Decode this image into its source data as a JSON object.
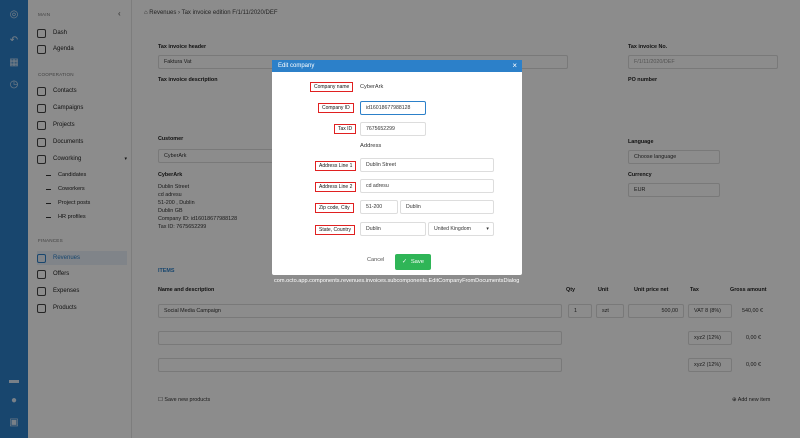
{
  "rail": {
    "icons": [
      "logo-icon",
      "back-icon",
      "grid-icon",
      "history-icon",
      "flag-icon",
      "user-icon",
      "lock-icon"
    ]
  },
  "sidebar": {
    "collapse": "‹",
    "main_heading": "MAIN",
    "main_items": [
      {
        "label": "Dash",
        "icon": "dashboard-icon"
      },
      {
        "label": "Agenda",
        "icon": "calendar-icon"
      }
    ],
    "coop_heading": "COOPERATION",
    "coop_items": [
      {
        "label": "Contacts",
        "icon": "contacts-icon"
      },
      {
        "label": "Campaigns",
        "icon": "campaigns-icon"
      },
      {
        "label": "Projects",
        "icon": "projects-icon"
      },
      {
        "label": "Documents",
        "icon": "documents-icon"
      },
      {
        "label": "Coworking",
        "icon": "coworking-icon"
      }
    ],
    "coworking_sub": [
      "Candidates",
      "Coworkers",
      "Project posts",
      "HR profiles"
    ],
    "finances_heading": "FINANCES",
    "finances_items": [
      {
        "label": "Revenues",
        "icon": "revenues-icon",
        "active": true
      },
      {
        "label": "Offers",
        "icon": "offers-icon"
      },
      {
        "label": "Expenses",
        "icon": "expenses-icon"
      },
      {
        "label": "Products",
        "icon": "products-icon"
      }
    ]
  },
  "breadcrumb": {
    "root": "Revenues",
    "separator": "›",
    "current": "Tax invoice edition F/1/11/2020/DEF"
  },
  "form": {
    "header_label": "Tax invoice header",
    "header_value": "Faktura Vat",
    "description_label": "Tax invoice description",
    "number_label": "Tax invoice No.",
    "number_value": "F/1/11/2020/DEF",
    "po_label": "PO number",
    "customer_label": "Customer",
    "customer_value": "CyberArk",
    "customer_name": "CyberArk",
    "customer_address": [
      "Dublin Street",
      "cd adresu",
      "51-200 , Dublin",
      "Dublin GB",
      "Company ID: id16018677988128",
      "Tax ID: 7675652299"
    ],
    "language_label": "Language",
    "language_value": "Choose language",
    "currency_label": "Currency",
    "currency_value": "EUR"
  },
  "items": {
    "title": "ITEMS",
    "columns": [
      "Name and description",
      "Qty",
      "Unit",
      "Unit price net",
      "Tax",
      "Gross amount"
    ],
    "rows": [
      {
        "name": "Social Media Campaign",
        "qty": "1",
        "unit": "szt",
        "price": "500,00",
        "tax": "VAT 8 (8%)",
        "gross": "540,00 €"
      },
      {
        "name": "",
        "qty": "",
        "unit": "",
        "price": "",
        "tax": "xyz2 (12%)",
        "gross": "0,00 €"
      },
      {
        "name": "",
        "qty": "",
        "unit": "",
        "price": "",
        "tax": "xyz2 (12%)",
        "gross": "0,00 €"
      }
    ],
    "save_new": "Save new products",
    "add_new": "Add new item"
  },
  "modal": {
    "title": "Edit company",
    "close": "×",
    "company_name_label": "Company name",
    "company_name_value": "CyberArk",
    "company_id_label": "Company ID",
    "company_id_value": "id16018677988128",
    "tax_id_label": "Tax ID",
    "tax_id_value": "7675652299",
    "address_heading": "Address",
    "address1_label": "Address Line 1",
    "address1_value": "Dublin Street",
    "address2_label": "Address Line 2",
    "address2_value": "cd adresu",
    "zip_label": "Zip code, City",
    "zip_value": "51-200",
    "city_value": "Dublin",
    "state_label": "State, Country",
    "state_value": "Dublin",
    "country_value": "United Kingdom",
    "cancel": "Cancel",
    "save": "Save"
  },
  "caption": "com.octo.app.components.revenues.invoices.subcomponents.EditCompanyFromDocumentsDialog",
  "colors": {
    "accent": "#2c80c9",
    "save": "#2fb557",
    "highlight": "#e02020"
  }
}
